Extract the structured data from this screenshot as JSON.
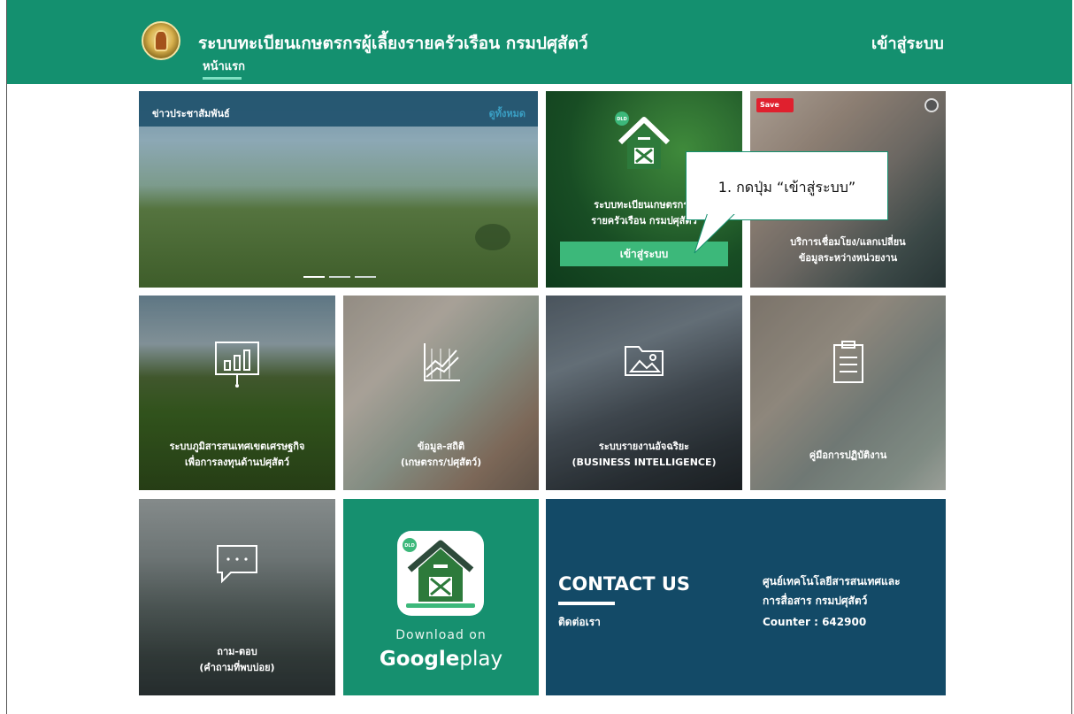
{
  "header": {
    "site_title": "ระบบทะเบียนเกษตรกรผู้เลี้ยงรายครัวเรือน กรมปศุสัตว์",
    "nav_home": "หน้าแรก",
    "login": "เข้าสู่ระบบ",
    "background_color": "#14906f"
  },
  "news": {
    "title": "ข่าวประชาสัมพันธ์",
    "view_all": "ดูทั้งหมด",
    "slide_count": 3,
    "active_slide": 1
  },
  "registration_tile": {
    "badge": "DLD",
    "label_line1": "ระบบทะเบียนเกษตรกรผู้",
    "label_line2": "รายครัวเรือน กรมปศุสัตว์",
    "button_label": "เข้าสู่ระบบ",
    "button_color": "#3cb87a"
  },
  "service_tile": {
    "save_label": "Save",
    "label_line1": "บริการเชื่อมโยง/แลกเปลี่ยน",
    "label_line2": "ข้อมูลระหว่างหน่วยงาน"
  },
  "callout": {
    "text": "1. กดปุ่ม “เข้าสู่ระบบ”"
  },
  "tiles": {
    "eco": {
      "line1": "ระบบภูมิสารสนเทศเขตเศรษฐกิจ",
      "line2": "เพื่อการลงทุนด้านปศุสัตว์"
    },
    "data": {
      "line1": "ข้อมูล-สถิติ",
      "line2": "(เกษตรกร/ปศุสัตว์)"
    },
    "bi": {
      "line1": "ระบบรายงานอัจฉริยะ",
      "line2": "(BUSINESS INTELLIGENCE)"
    },
    "manual": {
      "line1": "คู่มือการปฏิบัติงาน"
    },
    "faq": {
      "line1": "ถาม-ตอบ",
      "line2": "(คำถามที่พบบ่อย)"
    }
  },
  "app_tile": {
    "badge": "DLD",
    "download_on": "Download on",
    "store_bold": "Google",
    "store_light": "play",
    "background_color": "#16906f"
  },
  "contact": {
    "title": "CONTACT US",
    "subtitle": "ติดต่อเรา",
    "org_line1": "ศูนย์เทคโนโลยีสารสนเทศและ",
    "org_line2": "การสื่อสาร กรมปศุสัตว์",
    "counter": "Counter : 642900",
    "background_color": "#134a67"
  }
}
